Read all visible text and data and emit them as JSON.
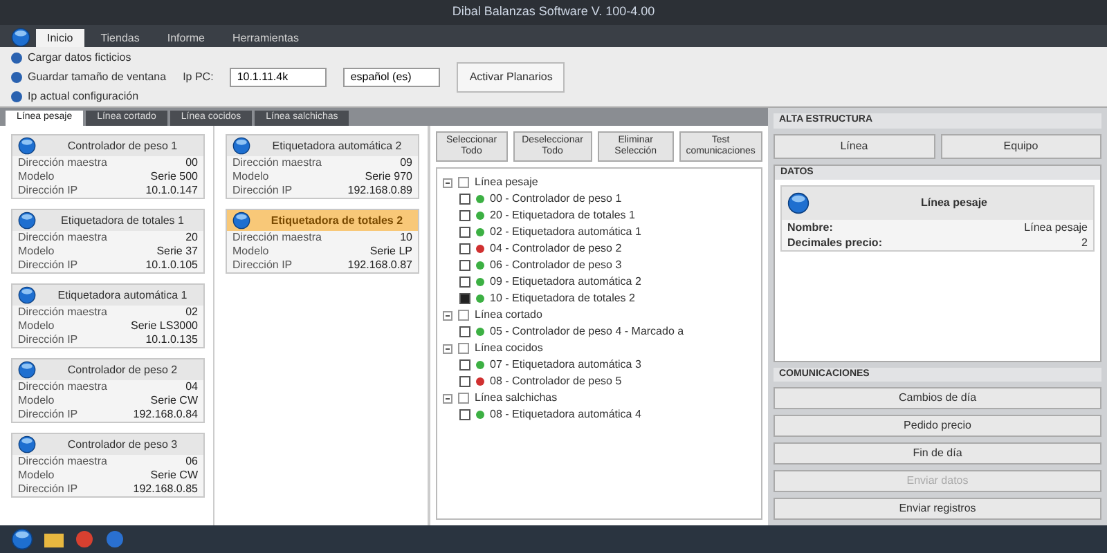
{
  "window": {
    "title": "Dibal Balanzas Software V. 100-4.00"
  },
  "ribbon_tabs": [
    {
      "label": "Inicio",
      "selected": true
    },
    {
      "label": "Tiendas",
      "selected": false
    },
    {
      "label": "Informe",
      "selected": false
    },
    {
      "label": "Herramientas",
      "selected": false
    }
  ],
  "ribbon": {
    "options": [
      {
        "label": "Cargar datos ficticios",
        "checked": true
      },
      {
        "label": "Guardar tamaño de ventana",
        "checked": true
      },
      {
        "label": "Ip actual configuración",
        "checked": true
      }
    ],
    "ip_label": "Ip PC:",
    "ip_value": "10.1.11.4k",
    "language_value": "español (es)",
    "action": "Activar Planarios"
  },
  "doc_tabs": [
    {
      "label": "Línea pesaje",
      "selected": true
    },
    {
      "label": "Línea cortado",
      "selected": false
    },
    {
      "label": "Línea cocidos",
      "selected": false
    },
    {
      "label": "Línea salchichas",
      "selected": false
    }
  ],
  "card_columns": [
    [
      {
        "title": "Controlador de peso 1",
        "selected": false,
        "fields": [
          [
            "Dirección maestra",
            "00"
          ],
          [
            "Modelo",
            "Serie 500"
          ],
          [
            "Dirección IP",
            "10.1.0.147"
          ]
        ]
      },
      {
        "title": "Etiquetadora de totales 1",
        "selected": false,
        "fields": [
          [
            "Dirección maestra",
            "20"
          ],
          [
            "Modelo",
            "Serie 37"
          ],
          [
            "Dirección IP",
            "10.1.0.105"
          ]
        ]
      },
      {
        "title": "Etiquetadora automática 1",
        "selected": false,
        "fields": [
          [
            "Dirección maestra",
            "02"
          ],
          [
            "Modelo",
            "Serie LS3000"
          ],
          [
            "Dirección IP",
            "10.1.0.135"
          ]
        ]
      },
      {
        "title": "Controlador de peso 2",
        "selected": false,
        "fields": [
          [
            "Dirección maestra",
            "04"
          ],
          [
            "Modelo",
            "Serie CW"
          ],
          [
            "Dirección IP",
            "192.168.0.84"
          ]
        ]
      },
      {
        "title": "Controlador de peso 3",
        "selected": false,
        "fields": [
          [
            "Dirección maestra",
            "06"
          ],
          [
            "Modelo",
            "Serie CW"
          ],
          [
            "Dirección IP",
            "192.168.0.85"
          ]
        ]
      }
    ],
    [
      {
        "title": "Etiquetadora automática 2",
        "selected": false,
        "fields": [
          [
            "Dirección maestra",
            "09"
          ],
          [
            "Modelo",
            "Serie 970"
          ],
          [
            "Dirección IP",
            "192.168.0.89"
          ]
        ]
      },
      {
        "title": "Etiquetadora de totales 2",
        "selected": true,
        "fields": [
          [
            "Dirección maestra",
            "10"
          ],
          [
            "Modelo",
            "Serie LP"
          ],
          [
            "Dirección IP",
            "192.168.0.87"
          ]
        ]
      }
    ]
  ],
  "tree_buttons": [
    "Seleccionar Todo",
    "Deseleccionar Todo",
    "Eliminar Selección",
    "Test comunicaciones"
  ],
  "tree": [
    {
      "label": "Línea pesaje",
      "expanded": true,
      "checked": false,
      "children": [
        {
          "label": "00 - Controlador de peso 1",
          "checked": false,
          "color": "#3cb043"
        },
        {
          "label": "20 - Etiquetadora de totales 1",
          "checked": false,
          "color": "#3cb043"
        },
        {
          "label": "02 - Etiquetadora automática 1",
          "checked": false,
          "color": "#3cb043"
        },
        {
          "label": "04 - Controlador de peso 2",
          "checked": false,
          "color": "#d03030"
        },
        {
          "label": "06 - Controlador de peso 3",
          "checked": false,
          "color": "#3cb043"
        },
        {
          "label": "09 - Etiquetadora automática 2",
          "checked": false,
          "color": "#3cb043"
        },
        {
          "label": "10 - Etiquetadora de totales 2",
          "checked": true,
          "color": "#3cb043"
        }
      ]
    },
    {
      "label": "Línea cortado",
      "expanded": true,
      "checked": false,
      "children": [
        {
          "label": "05 - Controlador de peso 4 - Marcado a",
          "checked": false,
          "color": "#3cb043"
        }
      ]
    },
    {
      "label": "Línea cocidos",
      "expanded": true,
      "checked": false,
      "children": [
        {
          "label": "07 - Etiquetadora automática 3",
          "checked": false,
          "color": "#3cb043"
        },
        {
          "label": "08 - Controlador de peso 5",
          "checked": false,
          "color": "#d03030"
        }
      ]
    },
    {
      "label": "Línea salchichas",
      "expanded": true,
      "checked": false,
      "children": [
        {
          "label": "08 - Etiquetadora automática 4",
          "checked": false,
          "color": "#3cb043"
        }
      ]
    }
  ],
  "structure": {
    "title": "ALTA ESTRUCTURA",
    "buttons": [
      "Línea",
      "Equipo"
    ]
  },
  "data_panel": {
    "title": "DATOS",
    "card_title": "Línea pesaje",
    "fields": [
      [
        "Nombre:",
        "Línea pesaje"
      ],
      [
        "Decimales precio:",
        "2"
      ]
    ]
  },
  "communications": {
    "title": "COMUNICACIONES",
    "buttons": [
      {
        "label": "Cambios de día",
        "disabled": false
      },
      {
        "label": "Pedido precio",
        "disabled": false
      },
      {
        "label": "Fin de día",
        "disabled": false
      },
      {
        "label": "Enviar datos",
        "disabled": true
      },
      {
        "label": "Enviar registros",
        "disabled": false
      }
    ]
  }
}
